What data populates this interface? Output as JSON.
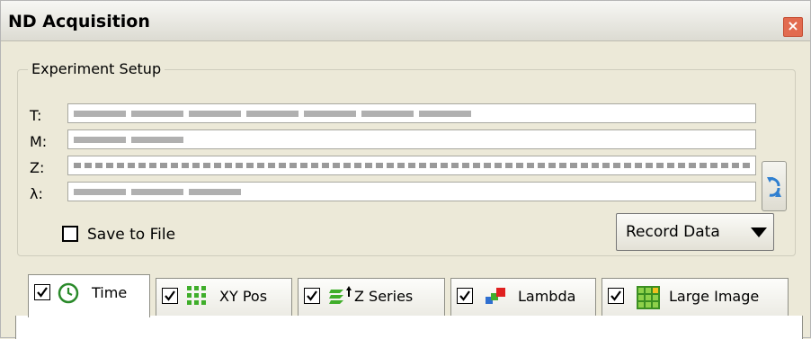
{
  "window": {
    "title": "ND Acquisition",
    "close_icon": "close-icon"
  },
  "experiment_setup": {
    "group_label": "Experiment Setup",
    "rows": [
      {
        "label": "T:"
      },
      {
        "label": "M:"
      },
      {
        "label": "Z:"
      },
      {
        "label": "λ:"
      }
    ],
    "save_to_file_label": "Save to File",
    "record_data_label": "Record Data"
  },
  "tabs": [
    {
      "label": "Time",
      "checked": true,
      "icon": "clock-icon"
    },
    {
      "label": "XY Pos",
      "checked": true,
      "icon": "grid-icon"
    },
    {
      "label": "Z Series",
      "checked": true,
      "icon": "z-stack-icon"
    },
    {
      "label": "Lambda",
      "checked": true,
      "icon": "lambda-icon"
    },
    {
      "label": "Large Image",
      "checked": true,
      "icon": "large-image-icon"
    }
  ]
}
